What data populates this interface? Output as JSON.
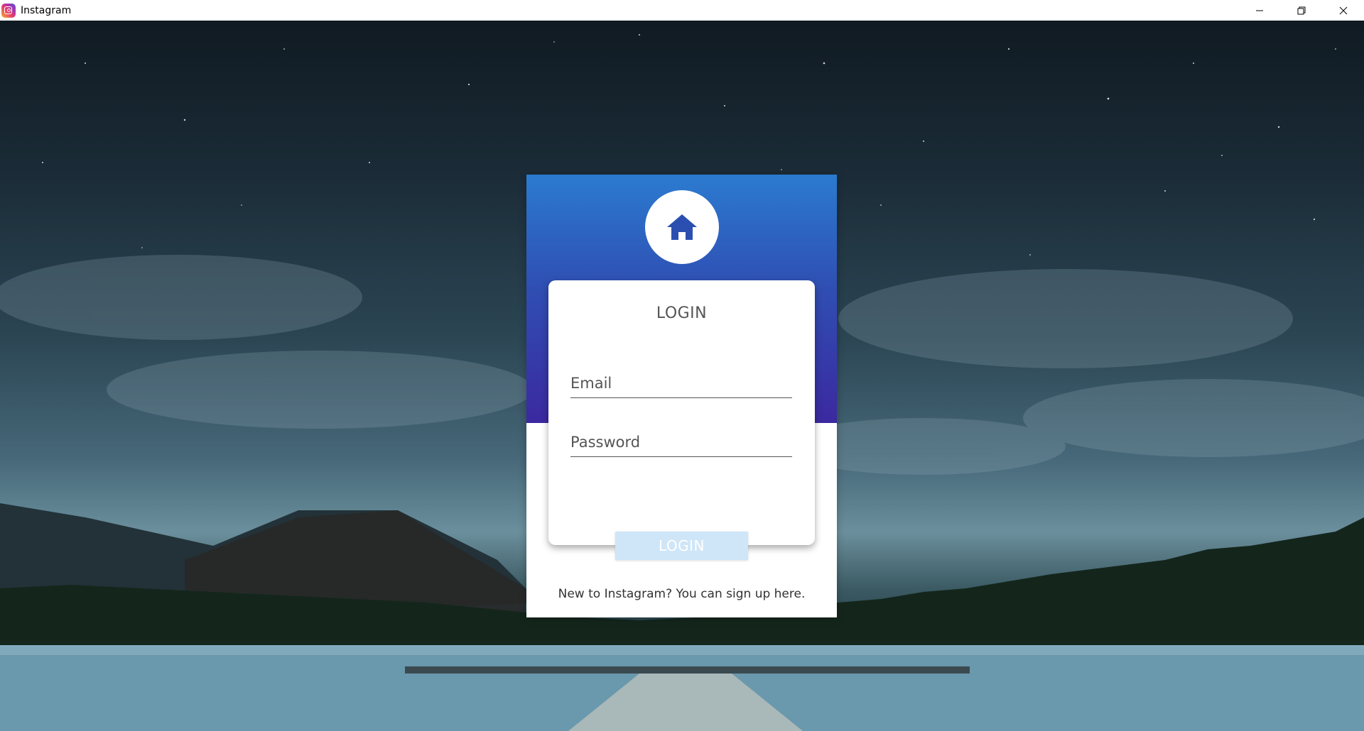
{
  "window": {
    "title": "Instagram",
    "icon": "instagram-logo-icon",
    "controls": [
      "minimize-icon",
      "restore-icon",
      "close-icon"
    ]
  },
  "colors": {
    "header_top": "#2b7bd0",
    "header_bottom": "#3b29a0",
    "home_icon": "#2b4fb0",
    "login_button_bg": "#cfe6f8"
  },
  "login_card": {
    "header_icon": "home-icon",
    "title": "LOGIN",
    "email_placeholder": "Email",
    "email_value": "",
    "password_placeholder": "Password",
    "password_value": "",
    "login_button_label": "LOGIN",
    "signup_prefix": "New to Instagram? You can ",
    "signup_link_label": "sign up here."
  }
}
